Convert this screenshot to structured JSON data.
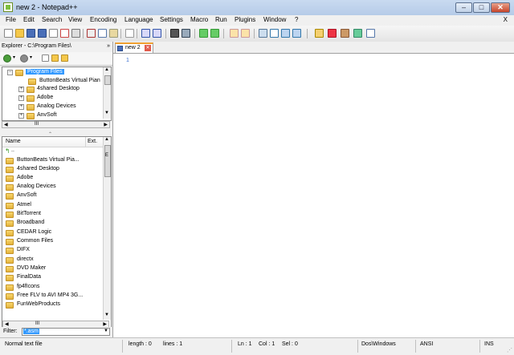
{
  "window": {
    "title": "new  2 - Notepad++",
    "minimize": "–",
    "maximize": "□",
    "close": "✕"
  },
  "menu": {
    "items": [
      "File",
      "Edit",
      "Search",
      "View",
      "Encoding",
      "Language",
      "Settings",
      "Macro",
      "Run",
      "Plugins",
      "Window",
      "?"
    ],
    "close_doc": "X"
  },
  "explorer": {
    "title": "Explorer - C:\\Program Files\\",
    "close": "»",
    "tree": {
      "items": [
        {
          "label": "Program Files",
          "selected": true
        },
        {
          "label": "ButtonBeats Virtual Pian"
        },
        {
          "label": "4shared Desktop"
        },
        {
          "label": "Adobe"
        },
        {
          "label": "Analog Devices"
        },
        {
          "label": "AnvSoft"
        }
      ],
      "scroll_h_label": "III"
    },
    "file_list": {
      "col_name": "Name",
      "col_ext": "Ext.",
      "scroll_marker": "E",
      "up_dir": "..",
      "items": [
        "ButtonBeats Virtual Pia...",
        "4shared Desktop",
        "Adobe",
        "Analog Devices",
        "AnvSoft",
        "Atmel",
        "BitTorrent",
        "Broadband",
        "CEDAR Logic",
        "Common Files",
        "DIFX",
        "directx",
        "DVD Maker",
        "FinalData",
        "fp4fIcons",
        "Free FLV to AVI MP4 3G...",
        "FunWebProducts"
      ],
      "scroll_h_label": "III"
    },
    "filter": {
      "label": "Filter:",
      "value": "*.asm"
    }
  },
  "editor": {
    "tab_label": "new  2",
    "line_number": "1"
  },
  "status": {
    "file_type": "Normal text file",
    "length": "length : 0",
    "lines": "lines : 1",
    "ln": "Ln : 1",
    "col": "Col : 1",
    "sel": "Sel : 0",
    "eol": "Dos\\Windows",
    "encoding": "ANSI",
    "mode": "INS"
  }
}
